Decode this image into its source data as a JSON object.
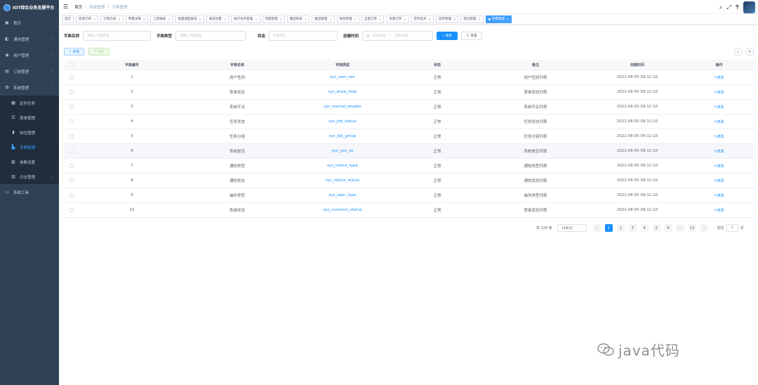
{
  "app": {
    "title": "IOT综合业务支撑平台"
  },
  "sidebar": {
    "items": [
      {
        "label": "首页",
        "icon": "dashboard-icon"
      },
      {
        "label": "通信管理",
        "icon": "communication-icon"
      },
      {
        "label": "用户管理",
        "icon": "user-icon"
      },
      {
        "label": "订单管理",
        "icon": "order-icon"
      },
      {
        "label": "系统管理",
        "icon": "gear-icon"
      },
      {
        "label": "系统工具",
        "icon": "tool-icon"
      }
    ],
    "sub": [
      {
        "label": "定时任务"
      },
      {
        "label": "菜单管理"
      },
      {
        "label": "岗位管理"
      },
      {
        "label": "字典管理"
      },
      {
        "label": "参数设置"
      },
      {
        "label": "日志管理"
      }
    ]
  },
  "breadcrumb": [
    "首页",
    "系统管理",
    "字典管理"
  ],
  "tags": [
    "首页",
    "资源订购",
    "订购历史",
    "用量详情",
    "上游通道",
    "批量速度查询",
    "通道流量",
    "执行任务管理",
    "内部管理",
    "集团列表",
    "集团管理",
    "角色管理",
    "全部订单",
    "资源订单",
    "定时任务",
    "菜单管理",
    "岗位管理",
    "字典管理"
  ],
  "search": {
    "name_label": "字典名称",
    "name_placeholder": "请输入字典名称",
    "type_label": "字典类型",
    "type_placeholder": "请输入字典类型",
    "status_label": "状态",
    "status_placeholder": "字典状态",
    "time_label": "创建时间",
    "start_placeholder": "开始日期",
    "range_sep": "-",
    "end_placeholder": "结束日期",
    "search_btn": "搜索",
    "reset_btn": "重置"
  },
  "toolbar": {
    "add": "新增",
    "edit": "修改"
  },
  "table": {
    "headers": [
      "字典编号",
      "字典名称",
      "字典类型",
      "状态",
      "备注",
      "创建时间",
      "操作"
    ],
    "op_label": "修改",
    "rows": [
      [
        "1",
        "用户性别",
        "sys_user_sex",
        "正常",
        "用户性别列表",
        "2021-06-05 09:12:10"
      ],
      [
        "2",
        "菜单状态",
        "sys_show_hide",
        "正常",
        "菜单状态列表",
        "2021-06-05 09:12:10"
      ],
      [
        "3",
        "系统开关",
        "sys_normal_disable",
        "正常",
        "系统开关列表",
        "2021-06-05 09:12:10"
      ],
      [
        "4",
        "任务状态",
        "sys_job_status",
        "正常",
        "任务状态列表",
        "2021-06-05 09:12:10"
      ],
      [
        "5",
        "任务分组",
        "sys_job_group",
        "正常",
        "任务分组列表",
        "2021-06-05 09:12:10"
      ],
      [
        "6",
        "系统是否",
        "sys_yes_no",
        "正常",
        "系统是否列表",
        "2021-06-05 09:12:10"
      ],
      [
        "7",
        "通知类型",
        "sys_notice_type",
        "正常",
        "通知类型列表",
        "2021-06-05 09:12:10"
      ],
      [
        "8",
        "通知状态",
        "sys_notice_status",
        "正常",
        "通知状态列表",
        "2021-06-05 09:12:10"
      ],
      [
        "9",
        "操作类型",
        "sys_oper_type",
        "正常",
        "操作类型列表",
        "2021-06-05 09:12:10"
      ],
      [
        "10",
        "系统状态",
        "sys_common_status",
        "正常",
        "登录状态列表",
        "2021-06-05 09:12:10"
      ]
    ]
  },
  "pager": {
    "total": "共 128 条",
    "size": "10条/页",
    "pages": [
      "1",
      "2",
      "3",
      "4",
      "5",
      "6",
      "···",
      "13"
    ],
    "goto": "前往",
    "goto_value": "1",
    "page_unit": "页"
  },
  "watermark": "java代码"
}
